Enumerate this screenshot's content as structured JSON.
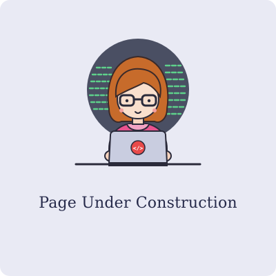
{
  "page": {
    "title": "Page Under Construction"
  },
  "illustration": {
    "subject": "girl-coding-on-laptop",
    "laptop_icon": "code-brackets-icon",
    "laptop_icon_text": "</>"
  },
  "colors": {
    "background": "#e9eaf4",
    "circle": "#4a4f63",
    "code_lines": "#5ed18b",
    "hair": "#c76b2b",
    "hoodie": "#e8528f",
    "laptop": "#c9cde0",
    "icon_badge": "#e84a4a",
    "title_text": "#262a4a"
  }
}
